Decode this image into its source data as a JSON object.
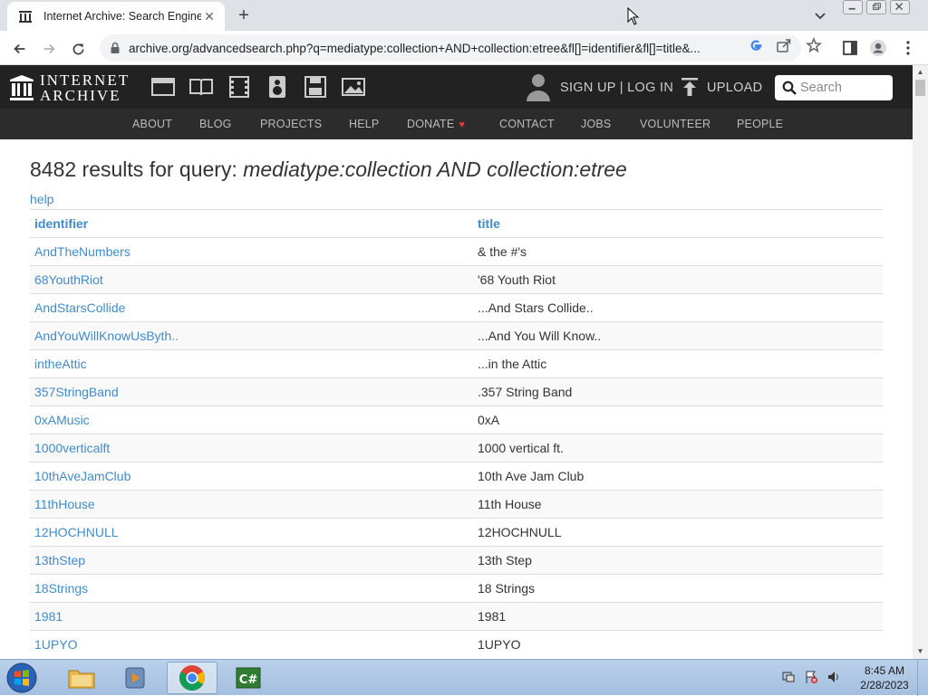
{
  "browser": {
    "tab_title": "Internet Archive: Search Engine",
    "url": "archive.org/advancedsearch.php?q=mediatype:collection+AND+collection:etree&fl[]=identifier&fl[]=title&..."
  },
  "ia_header": {
    "logo_line1": "INTERNET",
    "logo_line2": "ARCHIVE",
    "media_icons": [
      "web-icon",
      "texts-icon",
      "video-icon",
      "audio-icon",
      "software-icon",
      "images-icon"
    ],
    "signup_login": "SIGN UP | LOG IN",
    "upload": "UPLOAD",
    "search_placeholder": "Search"
  },
  "ia_nav": {
    "about": "ABOUT",
    "blog": "BLOG",
    "projects": "PROJECTS",
    "help": "HELP",
    "donate": "DONATE",
    "contact": "CONTACT",
    "jobs": "JOBS",
    "volunteer": "VOLUNTEER",
    "people": "PEOPLE"
  },
  "results": {
    "count_text": "8482 results for query:",
    "query": "mediatype:collection AND collection:etree",
    "help_link": "help",
    "columns": {
      "identifier": "identifier",
      "title": "title"
    },
    "rows": [
      {
        "identifier": "AndTheNumbers",
        "title": "& the #'s"
      },
      {
        "identifier": "68YouthRiot",
        "title": "'68 Youth Riot"
      },
      {
        "identifier": "AndStarsCollide",
        "title": "...And Stars Collide.."
      },
      {
        "identifier": "AndYouWillKnowUsByth..",
        "title": "...And You Will Know.."
      },
      {
        "identifier": "intheAttic",
        "title": "...in the Attic"
      },
      {
        "identifier": "357StringBand",
        "title": ".357 String Band"
      },
      {
        "identifier": "0xAMusic",
        "title": "0xA"
      },
      {
        "identifier": "1000verticalft",
        "title": "1000 vertical ft."
      },
      {
        "identifier": "10thAveJamClub",
        "title": "10th Ave Jam Club"
      },
      {
        "identifier": "11thHouse",
        "title": "11th House"
      },
      {
        "identifier": "12HOCHNULL",
        "title": "12HOCHNULL"
      },
      {
        "identifier": "13thStep",
        "title": "13th Step"
      },
      {
        "identifier": "18Strings",
        "title": "18 Strings"
      },
      {
        "identifier": "1981",
        "title": "1981"
      },
      {
        "identifier": "1UPYO",
        "title": "1UPYO"
      }
    ]
  },
  "taskbar": {
    "time": "8:45 AM",
    "date": "2/28/2023"
  },
  "colors": {
    "link": "#428bca",
    "ia_header_bg": "#222222",
    "ia_nav_bg": "#2c2c2c",
    "donate_heart": "#e53935"
  }
}
